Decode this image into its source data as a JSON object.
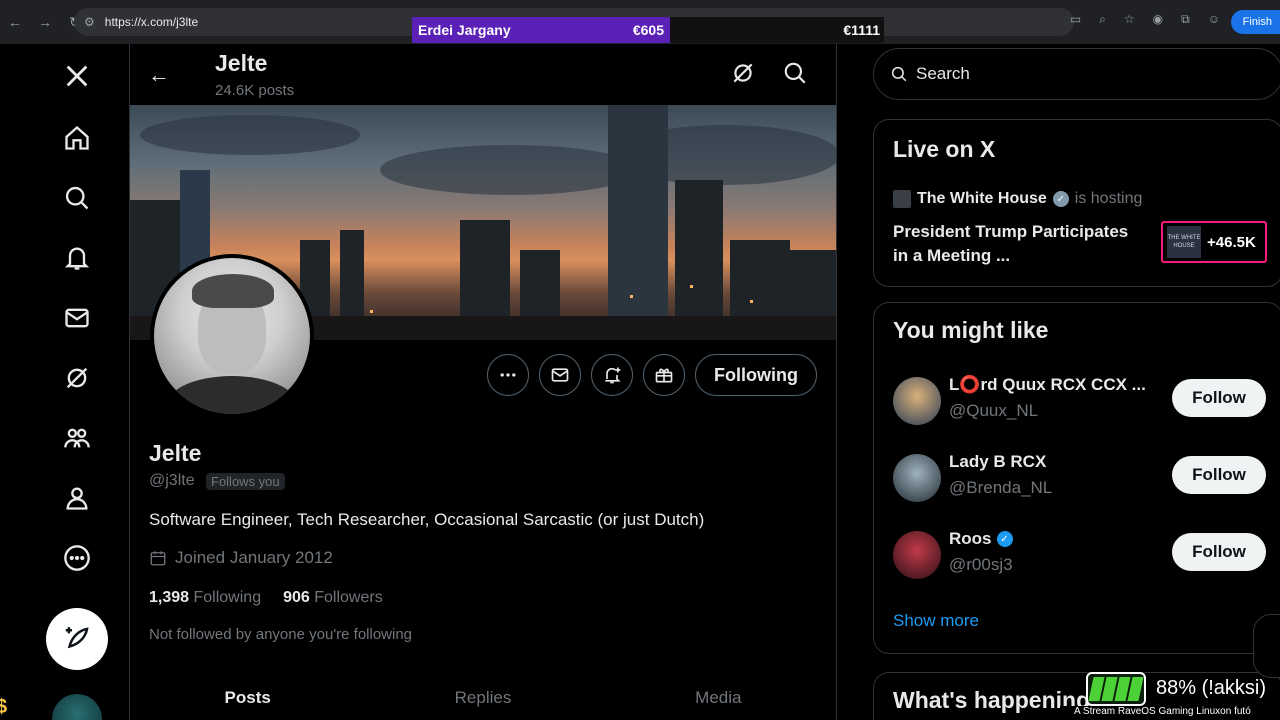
{
  "browser": {
    "url": "https://x.com/j3lte",
    "finish_label": "Finish"
  },
  "stream_overlay": {
    "bet_name": "Erdei Jargany",
    "bet_amount": "€605",
    "bet_total": "€1111",
    "battery_text": "88% (!akksi)",
    "ticker": "A Stream RaveOS Gaming Linuxon futó",
    "battery_level": 0.88
  },
  "profile": {
    "title": "Jelte",
    "post_count": "24.6K posts",
    "name": "Jelte",
    "handle": "@j3lte",
    "follows_you": "Follows you",
    "bio": "Software Engineer, Tech Researcher, Occasional Sarcastic (or just Dutch)",
    "joined": "Joined January 2012",
    "following_count": "1,398",
    "following_label": "Following",
    "followers_count": "906",
    "followers_label": "Followers",
    "not_followed": "Not followed by anyone you're following",
    "following_button": "Following"
  },
  "tabs": [
    {
      "label": "Posts",
      "active": true
    },
    {
      "label": "Replies",
      "active": false
    },
    {
      "label": "Media",
      "active": false
    }
  ],
  "sidebar": {
    "search_placeholder": "Search",
    "live": {
      "heading": "Live on X",
      "host_name": "The White House",
      "host_suffix": "is hosting",
      "title": "President Trump Participates in a Meeting ...",
      "viewer_count": "+46.5K",
      "thumb_text": "THE WHITE HOUSE"
    },
    "you_might_like": {
      "heading": "You might like",
      "people": [
        {
          "name": "L⭕rd Quux RCX CCX ...",
          "handle": "@Quux_NL",
          "verified": false,
          "button": "Follow"
        },
        {
          "name": "Lady B RCX",
          "handle": "@Brenda_NL",
          "verified": false,
          "button": "Follow"
        },
        {
          "name": "Roos",
          "handle": "@r00sj3",
          "verified": true,
          "button": "Follow"
        }
      ],
      "show_more": "Show more"
    },
    "whats_happening": "What's happening"
  },
  "colors": {
    "accent": "#1d9bf0",
    "live_border": "#f91880",
    "bet_bar": "#5b21b6"
  },
  "icons": [
    "x-logo-icon",
    "home-icon",
    "explore-icon",
    "notifications-icon",
    "messages-icon",
    "grok-icon",
    "communities-icon",
    "profile-icon",
    "more-icon",
    "compose-icon"
  ]
}
